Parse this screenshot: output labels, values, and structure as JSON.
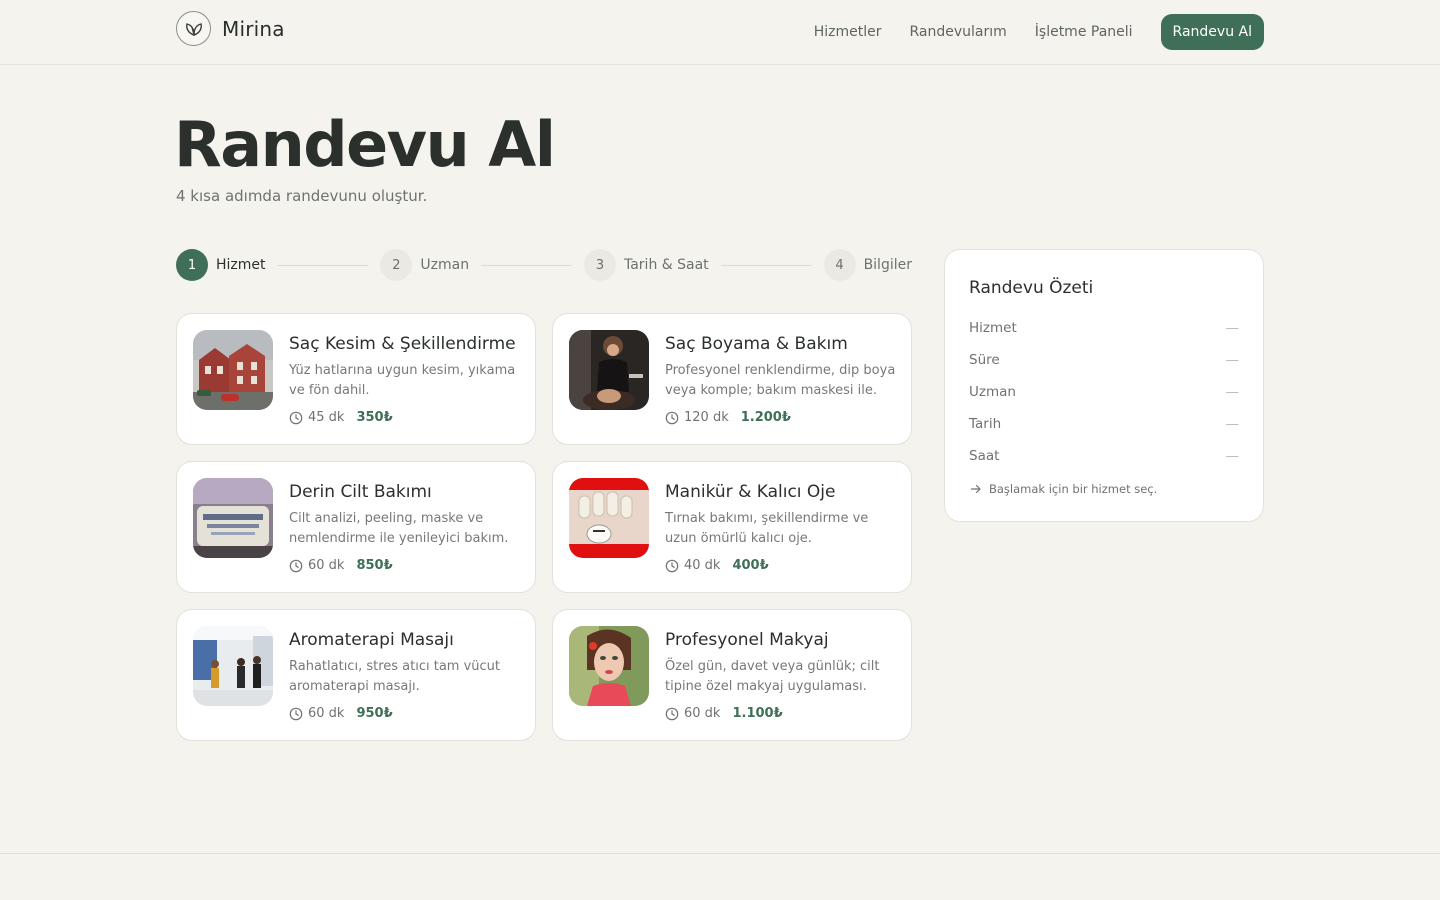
{
  "brand": {
    "name": "Mirina",
    "logo_icon": "leaf-icon"
  },
  "nav": {
    "links": [
      "Hizmetler",
      "Randevularım",
      "İşletme Paneli"
    ],
    "cta": "Randevu Al"
  },
  "page": {
    "title": "Randevu Al",
    "subtitle": "4 kısa adımda randevunu oluştur."
  },
  "steps": [
    {
      "num": "1",
      "label": "Hizmet",
      "active": true
    },
    {
      "num": "2",
      "label": "Uzman",
      "active": false
    },
    {
      "num": "3",
      "label": "Tarih & Saat",
      "active": false
    },
    {
      "num": "4",
      "label": "Bilgiler",
      "active": false
    }
  ],
  "services": [
    {
      "title": "Saç Kesim & Şekillendirme",
      "desc": "Yüz hatlarına uygun kesim, yıkama ve fön dahil.",
      "duration": "45 dk",
      "price": "350₺"
    },
    {
      "title": "Saç Boyama & Bakım",
      "desc": "Profesyonel renklendirme, dip boya veya komple; bakım maskesi ile.",
      "duration": "120 dk",
      "price": "1.200₺"
    },
    {
      "title": "Derin Cilt Bakımı",
      "desc": "Cilt analizi, peeling, maske ve nemlendirme ile yenileyici bakım.",
      "duration": "60 dk",
      "price": "850₺"
    },
    {
      "title": "Manikür & Kalıcı Oje",
      "desc": "Tırnak bakımı, şekillendirme ve uzun ömürlü kalıcı oje.",
      "duration": "40 dk",
      "price": "400₺"
    },
    {
      "title": "Aromaterapi Masajı",
      "desc": "Rahatlatıcı, stres atıcı tam vücut aromaterapi masajı.",
      "duration": "60 dk",
      "price": "950₺"
    },
    {
      "title": "Profesyonel Makyaj",
      "desc": "Özel gün, davet veya günlük; cilt tipine özel makyaj uygulaması.",
      "duration": "60 dk",
      "price": "1.100₺"
    }
  ],
  "summary": {
    "title": "Randevu Özeti",
    "rows": [
      {
        "label": "Hizmet",
        "value": "—"
      },
      {
        "label": "Süre",
        "value": "—"
      },
      {
        "label": "Uzman",
        "value": "—"
      },
      {
        "label": "Tarih",
        "value": "—"
      },
      {
        "label": "Saat",
        "value": "—"
      }
    ],
    "hint": "Başlamak için bir hizmet seç."
  },
  "colors": {
    "accent": "#3f6f57",
    "background": "#f5f3ee",
    "card": "#ffffff"
  }
}
